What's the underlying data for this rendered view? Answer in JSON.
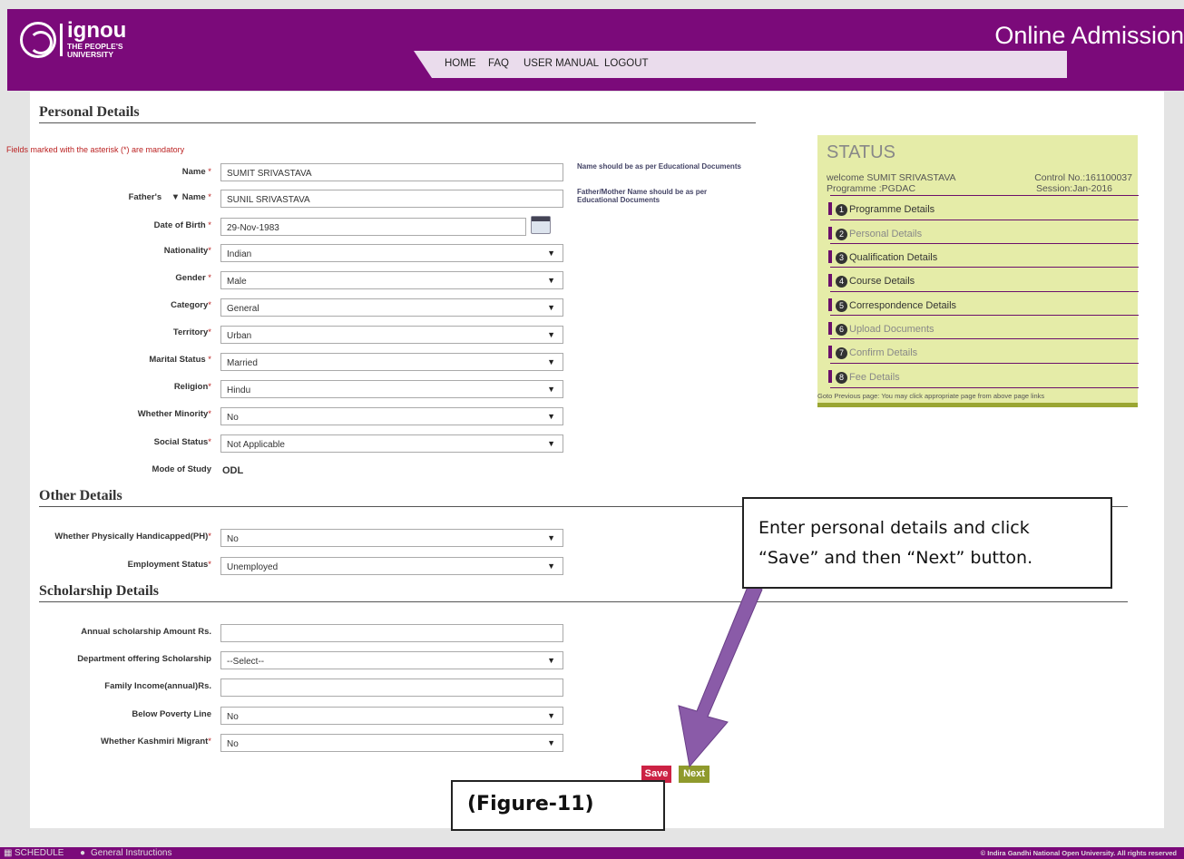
{
  "header": {
    "logo_word": "ignou",
    "logo_sub1": "THE PEOPLE'S",
    "logo_sub2": "UNIVERSITY",
    "title": "Online Admission",
    "nav": [
      "HOME",
      "FAQ",
      "USER MANUAL",
      "LOGOUT"
    ]
  },
  "personal": {
    "title": "Personal Details",
    "mandatory_note": "Fields marked with the asterisk (*) are mandatory",
    "fields": [
      {
        "label": "Name",
        "value": "SUMIT SRIVASTAVA"
      },
      {
        "label_a": "Father's",
        "label_b": "Name",
        "value": "SUNIL SRIVASTAVA"
      },
      {
        "label": "Date of Birth",
        "value": "29-Nov-1983"
      },
      {
        "label": "Nationality",
        "value": "Indian"
      },
      {
        "label": "Gender",
        "value": "Male"
      },
      {
        "label": "Category",
        "value": "General"
      },
      {
        "label": "Territory",
        "value": "Urban"
      },
      {
        "label": "Marital Status",
        "value": "Married"
      },
      {
        "label": "Religion",
        "value": "Hindu"
      },
      {
        "label": "Whether Minority",
        "value": "No"
      },
      {
        "label": "Social Status",
        "value": "Not Applicable"
      },
      {
        "label": "Mode of Study",
        "value": "ODL"
      }
    ],
    "hint_name": "Name should be as per Educational Documents",
    "hint_father": "Father/Mother Name should be as per Educational Documents"
  },
  "other": {
    "title": "Other Details",
    "fields": [
      {
        "label": "Whether Physically Handicapped(PH)",
        "value": "No"
      },
      {
        "label": "Employment Status",
        "value": "Unemployed"
      }
    ]
  },
  "scholarship": {
    "title": "Scholarship Details",
    "fields": [
      {
        "label": "Annual scholarship Amount Rs.",
        "value": ""
      },
      {
        "label": "Department offering Scholarship",
        "value": "--Select--"
      },
      {
        "label": "Family Income(annual)Rs.",
        "value": ""
      },
      {
        "label": "Below Poverty Line",
        "value": "No"
      },
      {
        "label": "Whether Kashmiri Migrant",
        "value": "No"
      }
    ]
  },
  "status": {
    "title": "STATUS",
    "welcome": "welcome SUMIT SRIVASTAVA",
    "control": "Control No.:161100037",
    "programme": "Programme :PGDAC",
    "session": "Session:Jan-2016",
    "steps": [
      {
        "num": "1",
        "label": "Programme Details"
      },
      {
        "num": "2",
        "label": "Personal Details"
      },
      {
        "num": "3",
        "label": "Qualification Details"
      },
      {
        "num": "4",
        "label": "Course Details"
      },
      {
        "num": "5",
        "label": "Correspondence Details"
      },
      {
        "num": "6",
        "label": "Upload Documents"
      },
      {
        "num": "7",
        "label": "Confirm Details"
      },
      {
        "num": "8",
        "label": "Fee Details"
      }
    ],
    "goto_note": "Goto Previous page: You may click appropriate page from above page links"
  },
  "buttons": {
    "save": "Save",
    "next": "Next"
  },
  "annotation": {
    "line1": "Enter personal details and click",
    "line2": "“Save” and then “Next” button.",
    "figure": "(Figure-11)"
  },
  "footer": {
    "schedule": "SCHEDULE",
    "instructions": "General Instructions",
    "copyright": "© Indira Gandhi National Open University. All rights reserved"
  },
  "colors": {
    "brand": "#7b0a7a",
    "status_bg": "#e5eca8",
    "save": "#cc2244",
    "next": "#8f9a2c",
    "arrow": "#8a5ba8"
  }
}
